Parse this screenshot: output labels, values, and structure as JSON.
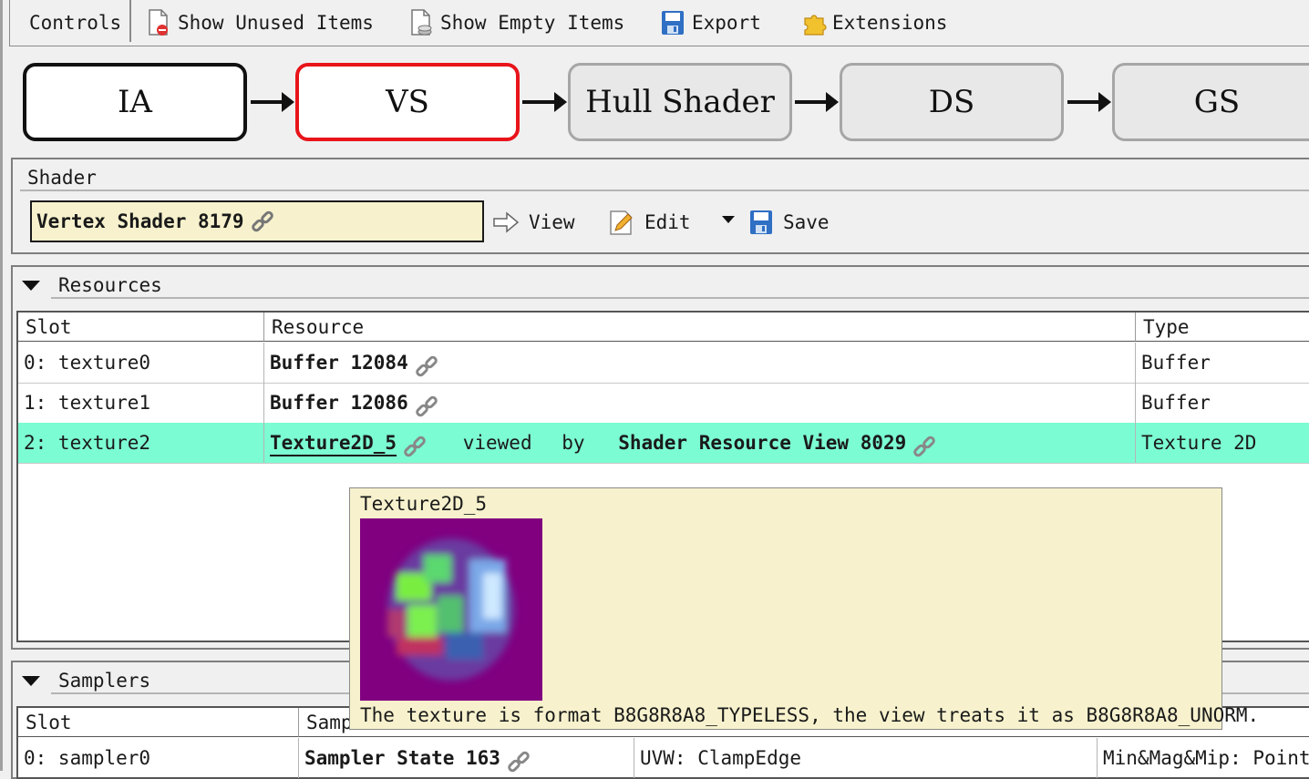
{
  "toolbar": {
    "controls_label": "Controls",
    "show_unused": "Show Unused Items",
    "show_empty": "Show Empty Items",
    "export": "Export",
    "extensions": "Extensions"
  },
  "pipeline": {
    "stages": [
      "IA",
      "VS",
      "Hull Shader",
      "DS",
      "GS"
    ],
    "selected": "VS"
  },
  "shader": {
    "group_label": "Shader",
    "name": "Vertex Shader 8179",
    "view_label": "View",
    "edit_label": "Edit",
    "save_label": "Save"
  },
  "resources": {
    "group_label": "Resources",
    "columns": [
      "Slot",
      "Resource",
      "Type"
    ],
    "rows": [
      {
        "slot": "0: texture0",
        "resource": "Buffer 12084",
        "type": "Buffer"
      },
      {
        "slot": "1: texture1",
        "resource": "Buffer 12086",
        "type": "Buffer"
      },
      {
        "slot": "2: texture2",
        "resource": "Texture2D_5",
        "viewed": "viewed",
        "by": "by",
        "view": "Shader Resource View 8029",
        "type": "Texture 2D"
      }
    ]
  },
  "tooltip": {
    "title": "Texture2D_5",
    "message": "The texture is format B8G8R8A8_TYPELESS, the view treats it as B8G8R8A8_UNORM."
  },
  "samplers": {
    "group_label": "Samplers",
    "columns": [
      "Slot",
      "Samp"
    ],
    "rows": [
      {
        "slot": "0: sampler0",
        "sampler": "Sampler State 163",
        "addressing": "UVW: ClampEdge",
        "filter": "Min&Mag&Mip: Point"
      }
    ]
  },
  "colors": {
    "selected_row": "#7cfcd2",
    "tooltip_bg": "#f7f2cd",
    "active_stage_border": "#e8141a"
  }
}
